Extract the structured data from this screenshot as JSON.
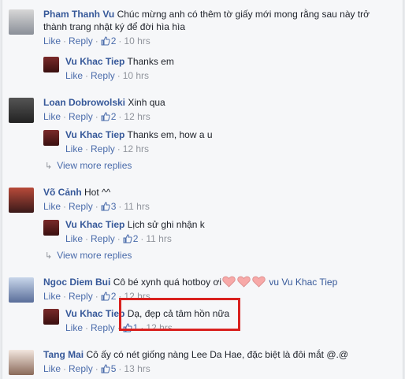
{
  "actions": {
    "like": "Like",
    "reply": "Reply",
    "sep": "·"
  },
  "comments": [
    {
      "name": "Pham Thanh Vu",
      "text": "Chúc mừng anh có thêm tờ giấy mới mong rằng sau này trở thành trang nhật ký để đời hìa hìa",
      "likes": "2",
      "time": "10 hrs",
      "reply": {
        "name": "Vu Khac Tiep",
        "text": "Thanks em",
        "time": "10 hrs"
      }
    },
    {
      "name": "Loan Dobrowolski",
      "text": "Xinh qua",
      "likes": "2",
      "time": "12 hrs",
      "reply": {
        "name": "Vu Khac Tiep",
        "text": "Thanks em, how a u",
        "time": "12 hrs"
      },
      "more": "View more replies"
    },
    {
      "name": "Võ Cảnh",
      "text": "Hot ^^",
      "likes": "3",
      "time": "11 hrs",
      "reply": {
        "name": "Vu Khac Tiep",
        "text": "Lịch sử ghi nhận k",
        "likes": "2",
        "time": "11 hrs"
      },
      "more": "View more replies"
    },
    {
      "name": "Ngoc Diem Bui",
      "text": "Cô bé xynh quá hotboy ơi",
      "mention": "vu Vu Khac Tiep",
      "likes": "2",
      "time": "12 hrs",
      "reply": {
        "name": "Vu Khac Tiep",
        "text": "Dạ, đẹp cả tâm hồn nữa",
        "likes": "1",
        "time": "12 hrs"
      }
    },
    {
      "name": "Tang Mai",
      "text": "Cô ấy có nét giống nàng Lee Da Hae, đặc biệt là đôi mắt @.@",
      "likes": "5",
      "time": "13 hrs"
    }
  ],
  "colors": {
    "link": "#365899",
    "action": "#4b6cab",
    "meta": "#90949c",
    "highlight": "#d9211f",
    "heart": "#f7a9a8"
  },
  "icons": {
    "like": "thumbs-up-icon",
    "more": "reply-arrow-icon",
    "heart": "heart-icon"
  }
}
